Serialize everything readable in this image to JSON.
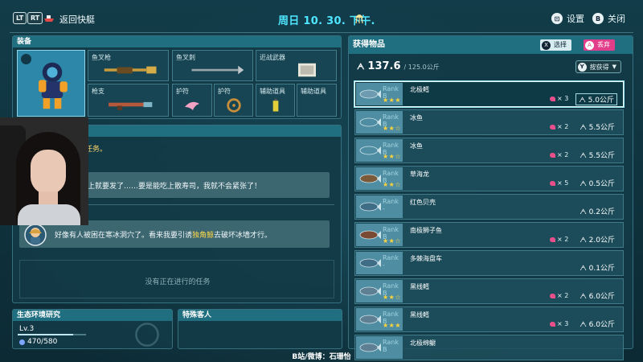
{
  "topbar": {
    "lt": "LT",
    "rt": "RT",
    "back_label": "返回快艇",
    "date": "周日 10. 30. 下午.",
    "settings_key": "⊡",
    "settings_label": "设置",
    "close_key": "B",
    "close_label": "关闭"
  },
  "equipment": {
    "title": "装备",
    "slots": [
      {
        "label": "鱼叉枪"
      },
      {
        "label": "鱼叉刺"
      },
      {
        "label": "近战武器"
      },
      {
        "label": "枪支"
      },
      {
        "label": "护符"
      },
      {
        "label": "护符"
      },
      {
        "label": "辅助道具"
      },
      {
        "label": "辅助道具"
      }
    ]
  },
  "quests": {
    "title": "任务。",
    "messages": [
      {
        "text": "马上就要发了……要是能吃上散寿司，我就不会紧张了！"
      },
      {
        "text_before": "好像有人被困在寒冰洞穴了。看来我要引诱",
        "highlight": "独角鲸",
        "text_after": "去破坏冰墙才行。"
      }
    ],
    "empty": "没有正在进行的任务"
  },
  "eco": {
    "title": "生态环境研究",
    "level": "Lv.3",
    "xp": "470/580",
    "xp_fraction": 0.81
  },
  "guest": {
    "title": "特殊客人"
  },
  "credit": "B站/微博：石珊怡",
  "items": {
    "title": "获得物品",
    "select_key": "X",
    "select_label": "选择",
    "discard_key": "A",
    "discard_label": "丢弃",
    "weight_icon": "ᗅ",
    "weight_value": "137.6",
    "weight_max": "/ 125.0公斤",
    "sort_key": "Y",
    "sort_label": "按获得",
    "list": [
      {
        "rank": "Rank B",
        "stars": "★★★",
        "name": "北极鳕",
        "qty": "× 3",
        "weight": "ᗅ 5.0公斤",
        "selected": true
      },
      {
        "rank": "Rank B",
        "stars": "★★☆",
        "name": "冰鱼",
        "qty": "× 2",
        "weight": "ᗅ 5.5公斤"
      },
      {
        "rank": "Rank B",
        "stars": "★★☆",
        "name": "冰鱼",
        "qty": "× 2",
        "weight": "ᗅ 5.5公斤"
      },
      {
        "rank": "Rank B",
        "stars": "★★☆",
        "name": "草海龙",
        "qty": "× 5",
        "weight": "ᗅ 0.5公斤"
      },
      {
        "rank": "Rank -",
        "stars": "",
        "name": "红色贝壳",
        "qty": "",
        "weight": "ᗅ 0.2公斤"
      },
      {
        "rank": "Rank B",
        "stars": "★★☆",
        "name": "南极狮子鱼",
        "qty": "× 2",
        "weight": "ᗅ 2.0公斤"
      },
      {
        "rank": "Rank -",
        "stars": "",
        "name": "多棘海盘车",
        "qty": "",
        "weight": "ᗅ 0.1公斤"
      },
      {
        "rank": "Rank B",
        "stars": "★★☆",
        "name": "黑线鳕",
        "qty": "× 2",
        "weight": "ᗅ 6.0公斤"
      },
      {
        "rank": "Rank B",
        "stars": "★★★",
        "name": "黑线鳕",
        "qty": "× 3",
        "weight": "ᗅ 6.0公斤"
      },
      {
        "rank": "Rank B",
        "stars": "",
        "name": "北极绵鳚",
        "qty": "",
        "weight": ""
      }
    ]
  },
  "colors": {
    "accent": "#4fe6ff",
    "panel_head": "#1f6f80",
    "discard": "#e23d8a",
    "select": "#d7ecf0",
    "star": "#ffd53a"
  }
}
